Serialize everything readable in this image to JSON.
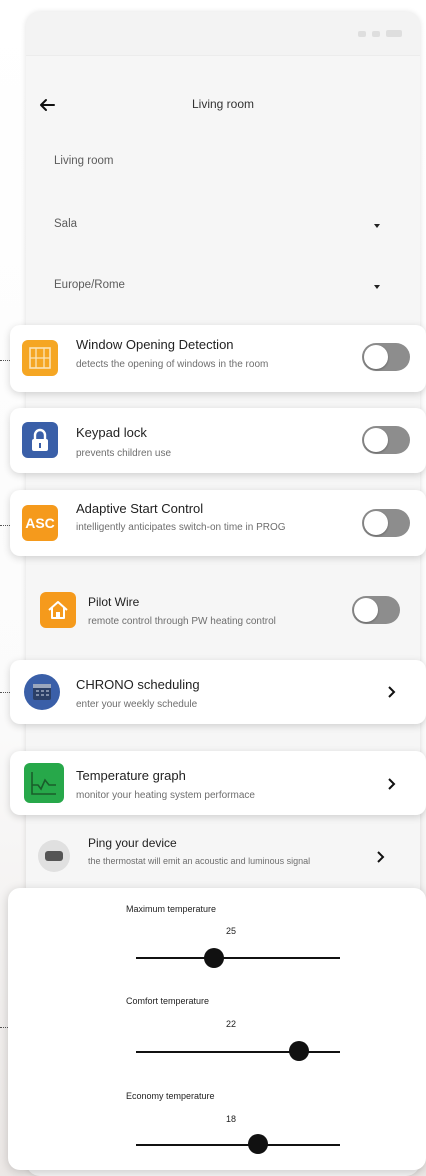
{
  "header": {
    "title": "Living room"
  },
  "fields": {
    "name": "Living room",
    "room_type": "Sala",
    "timezone": "Europe/Rome"
  },
  "settings": [
    {
      "title": "Window Opening Detection",
      "subtitle": "detects the opening of windows in the room",
      "icon": "window-icon",
      "icon_color": "#f5a623",
      "enabled": false
    },
    {
      "title": "Keypad lock",
      "subtitle": "prevents children use",
      "icon": "lock-icon",
      "icon_color": "#3a5fa8",
      "enabled": false
    },
    {
      "title": "Adaptive Start Control",
      "subtitle": "intelligently anticipates switch-on time in PROG",
      "icon": "asc-icon",
      "icon_text": "ASC",
      "icon_color": "#f59a1c",
      "enabled": false
    },
    {
      "title": "Pilot Wire",
      "subtitle": "remote control through PW heating control",
      "icon": "house-icon",
      "icon_color": "#f59a1c",
      "enabled": false
    }
  ],
  "nav_items": [
    {
      "title": "CHRONO scheduling",
      "subtitle": "enter your weekly schedule",
      "icon": "calendar-icon",
      "icon_color": "#3a5fa8"
    },
    {
      "title": "Temperature graph",
      "subtitle": "monitor your heating system performace",
      "icon": "graph-icon",
      "icon_color": "#27a84a"
    },
    {
      "title": "Ping your device",
      "subtitle": "the thermostat will emit an acoustic and luminous signal",
      "icon": "device-icon",
      "icon_color": "#e0e0e0"
    }
  ],
  "sliders": [
    {
      "label": "Maximum temperature",
      "value": "25",
      "fraction": 0.38
    },
    {
      "label": "Comfort temperature",
      "value": "22",
      "fraction": 0.8
    },
    {
      "label": "Economy temperature",
      "value": "18",
      "fraction": 0.6
    }
  ],
  "colors": {
    "toggle_off": "#8d8d8d",
    "background": "#f6f6f6",
    "card": "#ffffff"
  }
}
